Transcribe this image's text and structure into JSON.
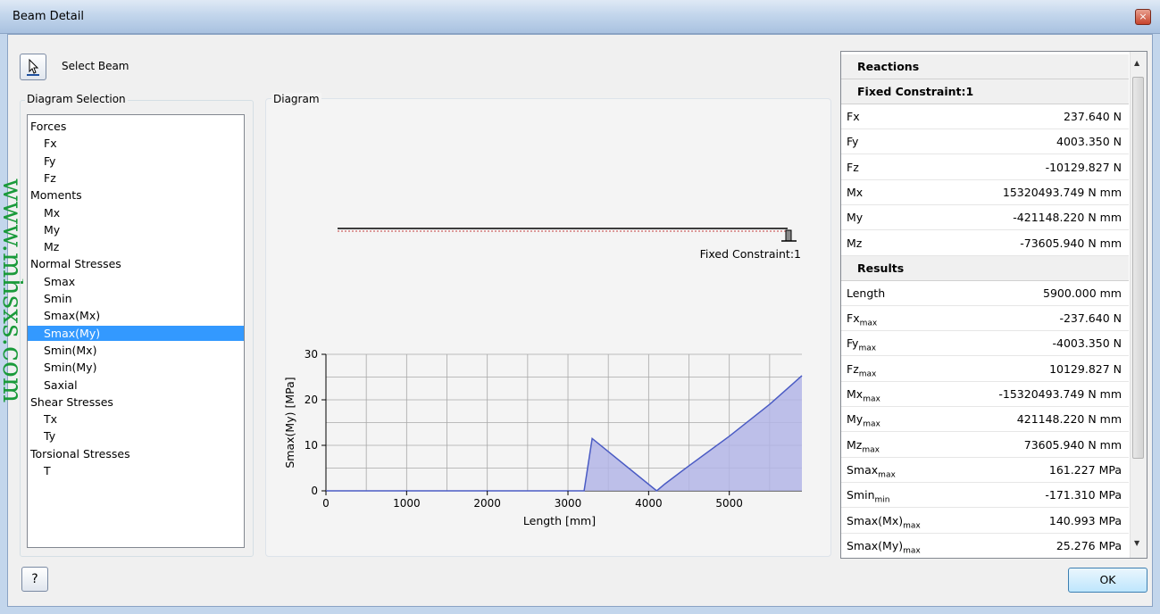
{
  "window": {
    "title": "Beam Detail",
    "close_symbol": "×"
  },
  "watermark": "www.mhsxs.com",
  "toolbar": {
    "select_beam_label": "Select Beam"
  },
  "diagram_selection": {
    "title": "Diagram Selection",
    "items": [
      {
        "label": "Forces",
        "level": 0
      },
      {
        "label": "Fx",
        "level": 1
      },
      {
        "label": "Fy",
        "level": 1
      },
      {
        "label": "Fz",
        "level": 1
      },
      {
        "label": "Moments",
        "level": 0
      },
      {
        "label": "Mx",
        "level": 1
      },
      {
        "label": "My",
        "level": 1
      },
      {
        "label": "Mz",
        "level": 1
      },
      {
        "label": "Normal Stresses",
        "level": 0
      },
      {
        "label": "Smax",
        "level": 1
      },
      {
        "label": "Smin",
        "level": 1
      },
      {
        "label": "Smax(Mx)",
        "level": 1
      },
      {
        "label": "Smax(My)",
        "level": 1,
        "selected": true
      },
      {
        "label": "Smin(Mx)",
        "level": 1
      },
      {
        "label": "Smin(My)",
        "level": 1
      },
      {
        "label": "Saxial",
        "level": 1
      },
      {
        "label": "Shear Stresses",
        "level": 0
      },
      {
        "label": "Tx",
        "level": 1
      },
      {
        "label": "Ty",
        "level": 1
      },
      {
        "label": "Torsional Stresses",
        "level": 0
      },
      {
        "label": "T",
        "level": 1
      }
    ]
  },
  "diagram": {
    "title": "Diagram",
    "beam_constraint_label": "Fixed Constraint:1"
  },
  "chart_data": {
    "type": "area",
    "xlabel": "Length [mm]",
    "ylabel": "Smax(My) [MPa]",
    "xlim": [
      0,
      5900
    ],
    "ylim": [
      0,
      30
    ],
    "xticks": [
      "0",
      "1000",
      "2000",
      "3000",
      "4000",
      "5000"
    ],
    "yticks": [
      "0",
      "10",
      "20",
      "30"
    ],
    "grid": true,
    "series": [
      {
        "x": [
          0,
          3200,
          3300,
          4100,
          4200,
          4500,
          5000,
          5500,
          5900
        ],
        "y": [
          0,
          0,
          11.5,
          0,
          1.5,
          5.5,
          12,
          19,
          25.3
        ]
      }
    ],
    "colors": {
      "line": "#4a5bc4",
      "fill": "#b3b5e6"
    }
  },
  "reactions": {
    "header": "Reactions",
    "sub_header": "Fixed Constraint:1",
    "rows": [
      {
        "k": "Fx",
        "v": "237.640 N"
      },
      {
        "k": "Fy",
        "v": "4003.350 N"
      },
      {
        "k": "Fz",
        "v": "-10129.827 N"
      },
      {
        "k": "Mx",
        "v": "15320493.749 N mm"
      },
      {
        "k": "My",
        "v": "-421148.220 N mm"
      },
      {
        "k": "Mz",
        "v": "-73605.940 N mm"
      }
    ]
  },
  "results": {
    "header": "Results",
    "rows": [
      {
        "k": "Length",
        "sub": "",
        "v": "5900.000 mm"
      },
      {
        "k": "Fx",
        "sub": "max",
        "v": "-237.640 N"
      },
      {
        "k": "Fy",
        "sub": "max",
        "v": "-4003.350 N"
      },
      {
        "k": "Fz",
        "sub": "max",
        "v": "10129.827 N"
      },
      {
        "k": "Mx",
        "sub": "max",
        "v": "-15320493.749 N mm"
      },
      {
        "k": "My",
        "sub": "max",
        "v": "421148.220 N mm"
      },
      {
        "k": "Mz",
        "sub": "max",
        "v": "73605.940 N mm"
      },
      {
        "k": "Smax",
        "sub": "max",
        "v": "161.227 MPa"
      },
      {
        "k": "Smin",
        "sub": "min",
        "v": "-171.310 MPa"
      },
      {
        "k": "Smax(Mx)",
        "sub": "max",
        "v": "140.993 MPa"
      },
      {
        "k": "Smax(My)",
        "sub": "max",
        "v": "25.276 MPa"
      }
    ]
  },
  "buttons": {
    "ok": "OK",
    "help_icon": "?"
  }
}
